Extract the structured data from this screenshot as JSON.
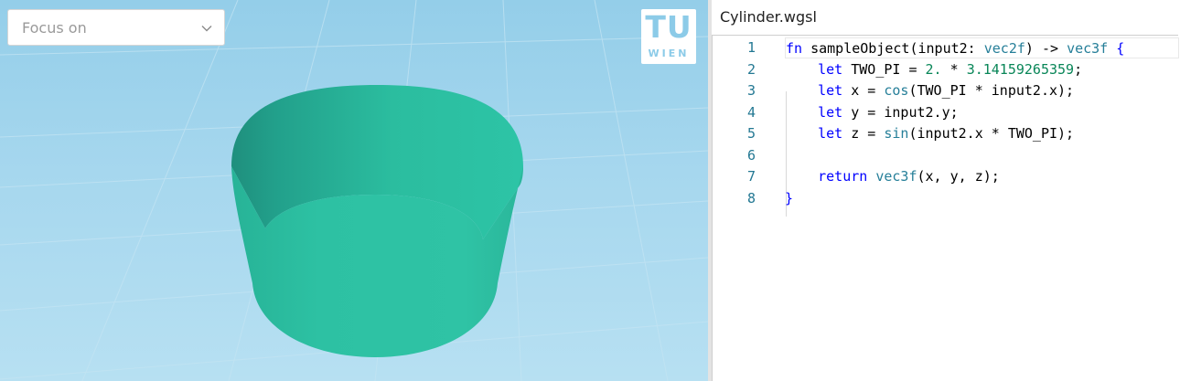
{
  "viewport": {
    "focus_select": {
      "placeholder": "Focus on"
    },
    "logo": {
      "line1": "TU",
      "line2": "WIEN"
    },
    "colors": {
      "background": "#a6d7ee",
      "grid": "#c3e4f3",
      "cylinder_front": "#2dbfa2",
      "cylinder_inner": "#23a08b"
    }
  },
  "editor": {
    "filename": "Cylinder.wgsl",
    "lines": [
      {
        "number": "1",
        "tokens": [
          {
            "t": "fn",
            "c": "kw"
          },
          {
            "t": " sampleObject(input2: ",
            "c": "pn"
          },
          {
            "t": "vec2f",
            "c": "ty"
          },
          {
            "t": ") -> ",
            "c": "pn"
          },
          {
            "t": "vec3f",
            "c": "ty"
          },
          {
            "t": " {",
            "c": "kw"
          }
        ]
      },
      {
        "number": "2",
        "tokens": [
          {
            "t": "    ",
            "c": "pn"
          },
          {
            "t": "let",
            "c": "kw"
          },
          {
            "t": " TWO_PI = ",
            "c": "pn"
          },
          {
            "t": "2.",
            "c": "num"
          },
          {
            "t": " * ",
            "c": "pn"
          },
          {
            "t": "3.14159265359",
            "c": "num"
          },
          {
            "t": ";",
            "c": "pn"
          }
        ]
      },
      {
        "number": "3",
        "tokens": [
          {
            "t": "    ",
            "c": "pn"
          },
          {
            "t": "let",
            "c": "kw"
          },
          {
            "t": " x = ",
            "c": "pn"
          },
          {
            "t": "cos",
            "c": "ty"
          },
          {
            "t": "(TWO_PI * input2.x);",
            "c": "pn"
          }
        ]
      },
      {
        "number": "4",
        "tokens": [
          {
            "t": "    ",
            "c": "pn"
          },
          {
            "t": "let",
            "c": "kw"
          },
          {
            "t": " y = input2.y;",
            "c": "pn"
          }
        ]
      },
      {
        "number": "5",
        "tokens": [
          {
            "t": "    ",
            "c": "pn"
          },
          {
            "t": "let",
            "c": "kw"
          },
          {
            "t": " z = ",
            "c": "pn"
          },
          {
            "t": "sin",
            "c": "ty"
          },
          {
            "t": "(input2.x * TWO_PI);",
            "c": "pn"
          }
        ]
      },
      {
        "number": "6",
        "tokens": []
      },
      {
        "number": "7",
        "tokens": [
          {
            "t": "    ",
            "c": "pn"
          },
          {
            "t": "return",
            "c": "kw"
          },
          {
            "t": " ",
            "c": "pn"
          },
          {
            "t": "vec3f",
            "c": "ty"
          },
          {
            "t": "(x, y, z);",
            "c": "pn"
          }
        ]
      },
      {
        "number": "8",
        "tokens": [
          {
            "t": "}",
            "c": "kw"
          }
        ]
      }
    ]
  }
}
